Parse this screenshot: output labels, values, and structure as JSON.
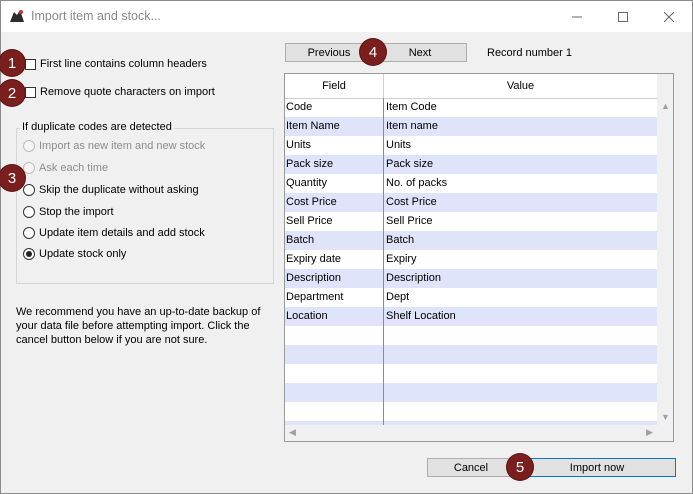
{
  "window": {
    "title": "Import item and stock...",
    "controls": {
      "minimize": "minimize-icon",
      "maximize": "maximize-icon",
      "close": "close-icon"
    }
  },
  "options": {
    "first_line_headers": {
      "label": "First line contains column headers",
      "checked": false
    },
    "remove_quotes": {
      "label": "Remove quote characters on import",
      "checked": false
    }
  },
  "duplicates": {
    "title": "If duplicate codes are detected",
    "choices": [
      {
        "label": "Import as new item and new stock",
        "enabled": false,
        "selected": false
      },
      {
        "label": "Ask each time",
        "enabled": false,
        "selected": false
      },
      {
        "label": "Skip the duplicate without asking",
        "enabled": true,
        "selected": false
      },
      {
        "label": "Stop the import",
        "enabled": true,
        "selected": false
      },
      {
        "label": "Update item details and add stock",
        "enabled": true,
        "selected": false
      },
      {
        "label": "Update stock only",
        "enabled": true,
        "selected": true
      }
    ]
  },
  "note": "We recommend you have an up-to-date backup of your data file before attempting import. Click the cancel button below if you are not sure.",
  "navigation": {
    "previous": "Previous",
    "next": "Next",
    "record_label": "Record number 1"
  },
  "table": {
    "headers": {
      "field": "Field",
      "value": "Value"
    },
    "rows": [
      {
        "field": "Code",
        "value": "Item Code"
      },
      {
        "field": "Item Name",
        "value": "Item name"
      },
      {
        "field": "Units",
        "value": "Units"
      },
      {
        "field": "Pack size",
        "value": "Pack size"
      },
      {
        "field": "Quantity",
        "value": "No. of packs"
      },
      {
        "field": "Cost Price",
        "value": "Cost Price"
      },
      {
        "field": "Sell Price",
        "value": "Sell Price"
      },
      {
        "field": "Batch",
        "value": "Batch"
      },
      {
        "field": "Expiry date",
        "value": "Expiry"
      },
      {
        "field": "Description",
        "value": "Description"
      },
      {
        "field": "Department",
        "value": "Dept"
      },
      {
        "field": "Location",
        "value": "Shelf Location"
      },
      {
        "field": "",
        "value": ""
      },
      {
        "field": "",
        "value": ""
      },
      {
        "field": "",
        "value": ""
      },
      {
        "field": "",
        "value": ""
      },
      {
        "field": "",
        "value": ""
      },
      {
        "field": "",
        "value": ""
      }
    ]
  },
  "buttons": {
    "cancel": "Cancel",
    "import": "Import now"
  },
  "callouts": [
    "1",
    "2",
    "3",
    "4",
    "5"
  ],
  "colors": {
    "callout": "#7b1e1e",
    "row_alt": "#dfe4fb"
  }
}
